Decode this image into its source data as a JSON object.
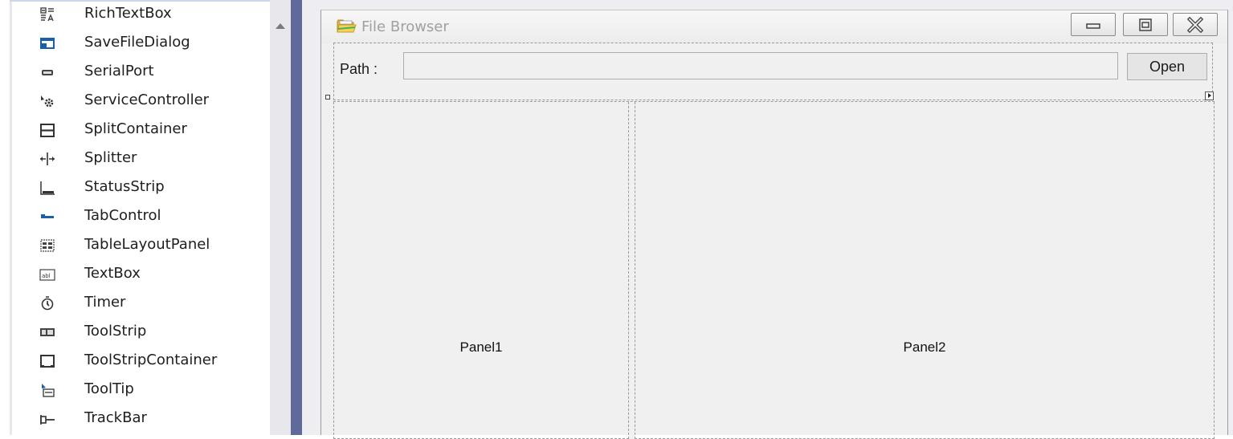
{
  "toolbox": {
    "items": [
      {
        "label": "RichTextBox",
        "icon": "richtextbox-icon"
      },
      {
        "label": "SaveFileDialog",
        "icon": "savefiledialog-icon"
      },
      {
        "label": "SerialPort",
        "icon": "serialport-icon"
      },
      {
        "label": "ServiceController",
        "icon": "servicecontroller-icon"
      },
      {
        "label": "SplitContainer",
        "icon": "splitcontainer-icon"
      },
      {
        "label": "Splitter",
        "icon": "splitter-icon"
      },
      {
        "label": "StatusStrip",
        "icon": "statusstrip-icon"
      },
      {
        "label": "TabControl",
        "icon": "tabcontrol-icon"
      },
      {
        "label": "TableLayoutPanel",
        "icon": "tablelayoutpanel-icon"
      },
      {
        "label": "TextBox",
        "icon": "textbox-icon"
      },
      {
        "label": "Timer",
        "icon": "timer-icon"
      },
      {
        "label": "ToolStrip",
        "icon": "toolstrip-icon"
      },
      {
        "label": "ToolStripContainer",
        "icon": "toolstripcontainer-icon"
      },
      {
        "label": "ToolTip",
        "icon": "tooltip-icon"
      },
      {
        "label": "TrackBar",
        "icon": "trackbar-icon"
      }
    ]
  },
  "form": {
    "title": "File Browser",
    "icon": "folder-icon",
    "path_label": "Path :",
    "path_value": "",
    "open_button": "Open",
    "panel1_label": "Panel1",
    "panel2_label": "Panel2"
  },
  "colors": {
    "separator": "#5f6a9b",
    "designer_background": "#eeeef2",
    "form_background": "#f0f0f0"
  }
}
